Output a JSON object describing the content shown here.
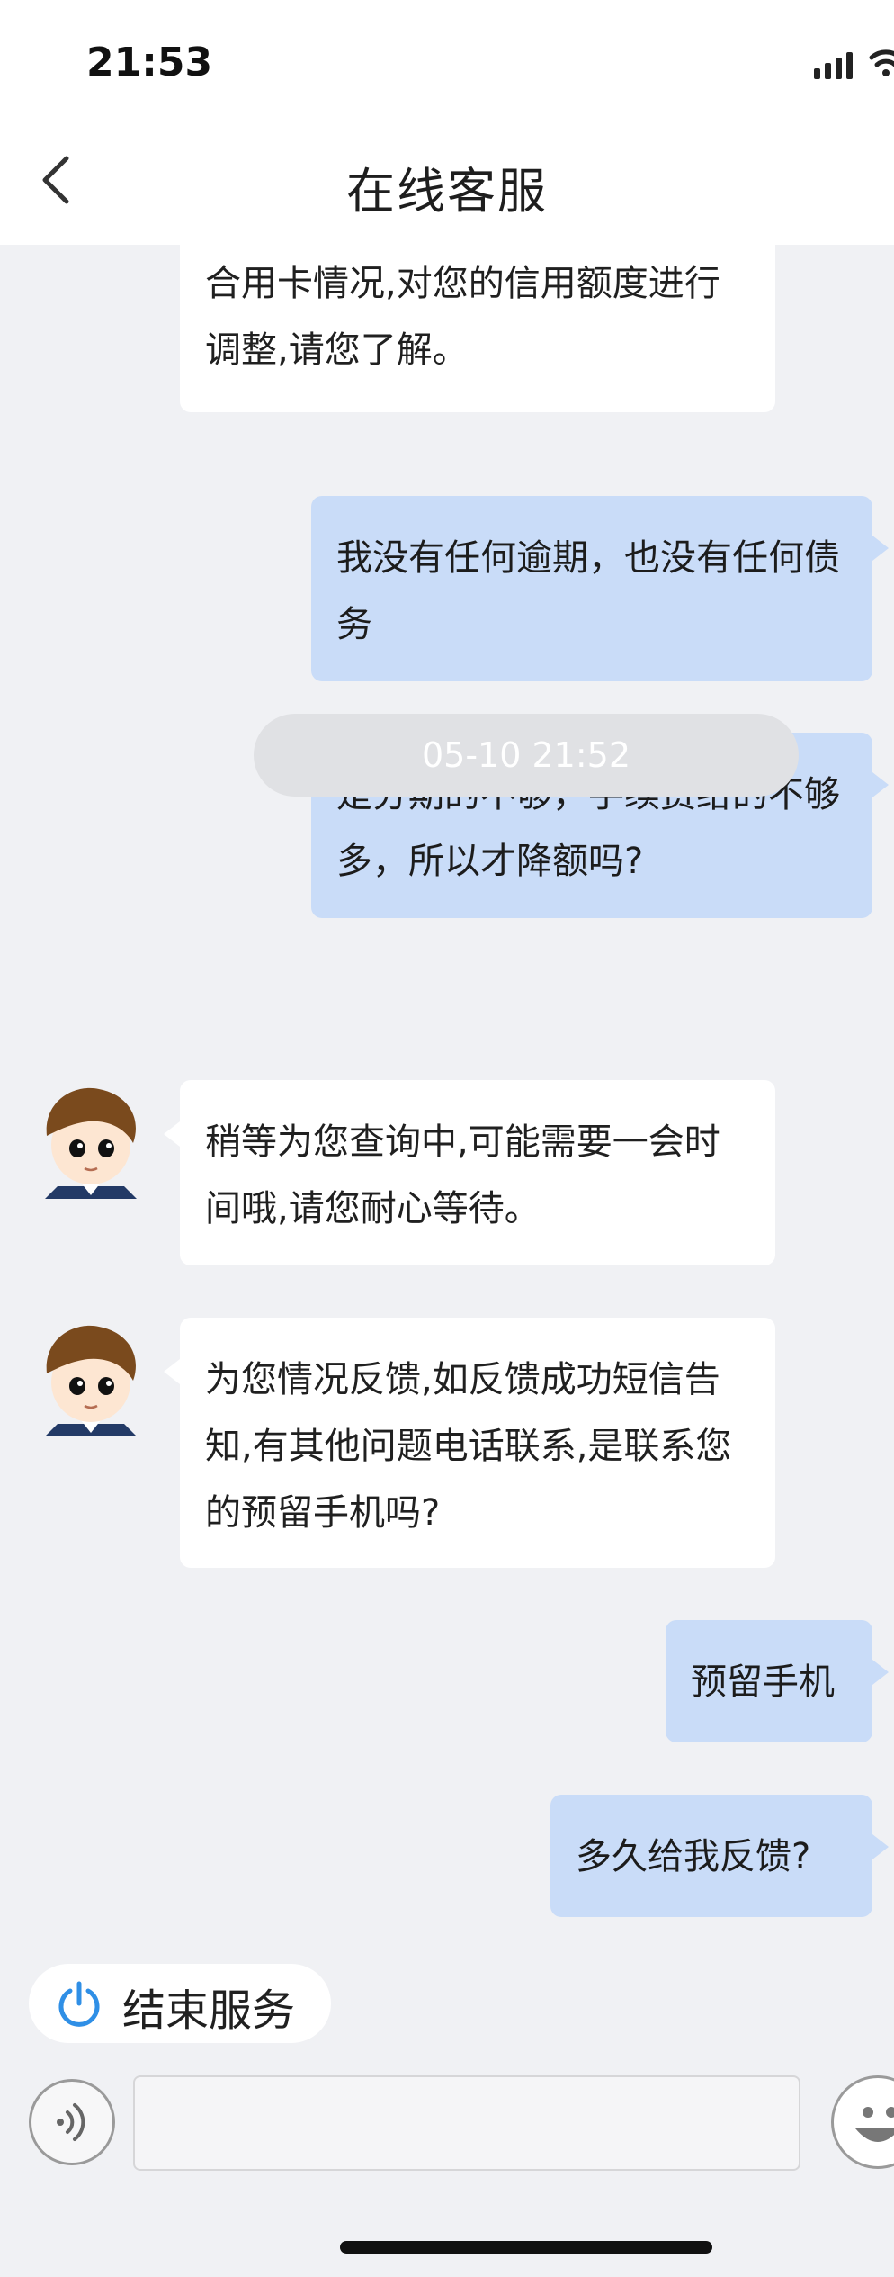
{
  "status_bar": {
    "time": "21:53"
  },
  "header": {
    "title": "在线客服"
  },
  "messages": [
    {
      "from": "agent",
      "text": "做综合评分,目前也是根据您的综合用卡情况,对您的信用额度进行调整,请您了解。"
    },
    {
      "from": "user",
      "text": "我没有任何逾期，也没有任何债务"
    },
    {
      "from": "user",
      "text": "是分期的不够，手续费给的不够多，所以才降额吗?"
    },
    {
      "from": "agent",
      "text": "稍等为您查询中,可能需要一会时间哦,请您耐心等待。"
    },
    {
      "from": "agent",
      "text": "为您情况反馈,如反馈成功短信告知,有其他问题电话联系,是联系您的预留手机吗?"
    },
    {
      "from": "user",
      "text": "预留手机"
    },
    {
      "from": "user",
      "text": "多久给我反馈?"
    }
  ],
  "timestamp": "05-10 21:52",
  "footer": {
    "end_service_label": "结束服务",
    "input_value": ""
  },
  "colors": {
    "user_bubble": "#c9dcf8",
    "agent_bubble": "#ffffff",
    "background": "#f0f1f4",
    "accent": "#2f8fe6"
  },
  "icons": [
    "back-icon",
    "signal-icon",
    "wifi-icon",
    "power-icon",
    "voice-icon",
    "emoji-icon"
  ]
}
